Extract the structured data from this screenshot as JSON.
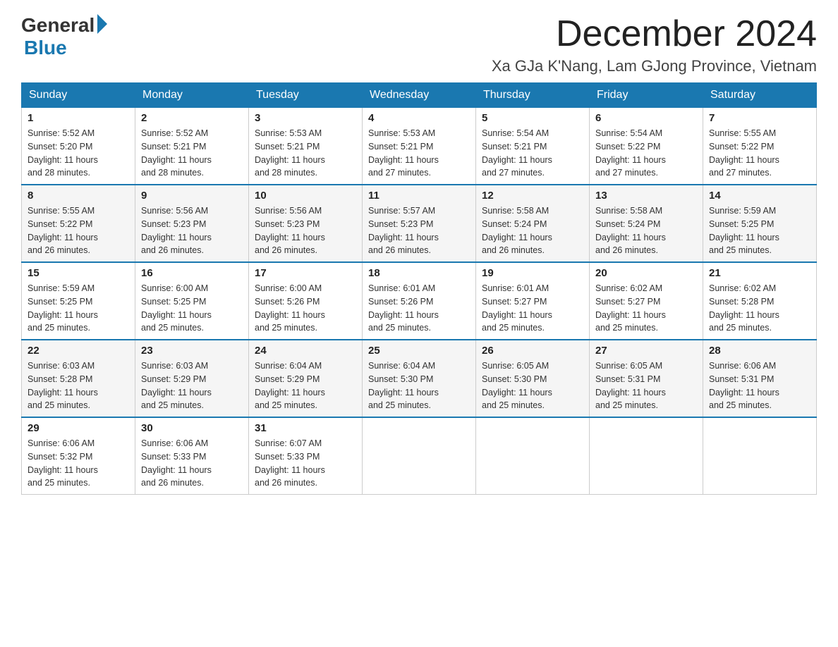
{
  "header": {
    "logo_general": "General",
    "logo_blue": "Blue",
    "month_title": "December 2024",
    "location": "Xa GJa K'Nang, Lam GJong Province, Vietnam"
  },
  "days_of_week": [
    "Sunday",
    "Monday",
    "Tuesday",
    "Wednesday",
    "Thursday",
    "Friday",
    "Saturday"
  ],
  "weeks": [
    [
      {
        "day": "1",
        "sunrise": "5:52 AM",
        "sunset": "5:20 PM",
        "daylight": "11 hours and 28 minutes."
      },
      {
        "day": "2",
        "sunrise": "5:52 AM",
        "sunset": "5:21 PM",
        "daylight": "11 hours and 28 minutes."
      },
      {
        "day": "3",
        "sunrise": "5:53 AM",
        "sunset": "5:21 PM",
        "daylight": "11 hours and 28 minutes."
      },
      {
        "day": "4",
        "sunrise": "5:53 AM",
        "sunset": "5:21 PM",
        "daylight": "11 hours and 27 minutes."
      },
      {
        "day": "5",
        "sunrise": "5:54 AM",
        "sunset": "5:21 PM",
        "daylight": "11 hours and 27 minutes."
      },
      {
        "day": "6",
        "sunrise": "5:54 AM",
        "sunset": "5:22 PM",
        "daylight": "11 hours and 27 minutes."
      },
      {
        "day": "7",
        "sunrise": "5:55 AM",
        "sunset": "5:22 PM",
        "daylight": "11 hours and 27 minutes."
      }
    ],
    [
      {
        "day": "8",
        "sunrise": "5:55 AM",
        "sunset": "5:22 PM",
        "daylight": "11 hours and 26 minutes."
      },
      {
        "day": "9",
        "sunrise": "5:56 AM",
        "sunset": "5:23 PM",
        "daylight": "11 hours and 26 minutes."
      },
      {
        "day": "10",
        "sunrise": "5:56 AM",
        "sunset": "5:23 PM",
        "daylight": "11 hours and 26 minutes."
      },
      {
        "day": "11",
        "sunrise": "5:57 AM",
        "sunset": "5:23 PM",
        "daylight": "11 hours and 26 minutes."
      },
      {
        "day": "12",
        "sunrise": "5:58 AM",
        "sunset": "5:24 PM",
        "daylight": "11 hours and 26 minutes."
      },
      {
        "day": "13",
        "sunrise": "5:58 AM",
        "sunset": "5:24 PM",
        "daylight": "11 hours and 26 minutes."
      },
      {
        "day": "14",
        "sunrise": "5:59 AM",
        "sunset": "5:25 PM",
        "daylight": "11 hours and 25 minutes."
      }
    ],
    [
      {
        "day": "15",
        "sunrise": "5:59 AM",
        "sunset": "5:25 PM",
        "daylight": "11 hours and 25 minutes."
      },
      {
        "day": "16",
        "sunrise": "6:00 AM",
        "sunset": "5:25 PM",
        "daylight": "11 hours and 25 minutes."
      },
      {
        "day": "17",
        "sunrise": "6:00 AM",
        "sunset": "5:26 PM",
        "daylight": "11 hours and 25 minutes."
      },
      {
        "day": "18",
        "sunrise": "6:01 AM",
        "sunset": "5:26 PM",
        "daylight": "11 hours and 25 minutes."
      },
      {
        "day": "19",
        "sunrise": "6:01 AM",
        "sunset": "5:27 PM",
        "daylight": "11 hours and 25 minutes."
      },
      {
        "day": "20",
        "sunrise": "6:02 AM",
        "sunset": "5:27 PM",
        "daylight": "11 hours and 25 minutes."
      },
      {
        "day": "21",
        "sunrise": "6:02 AM",
        "sunset": "5:28 PM",
        "daylight": "11 hours and 25 minutes."
      }
    ],
    [
      {
        "day": "22",
        "sunrise": "6:03 AM",
        "sunset": "5:28 PM",
        "daylight": "11 hours and 25 minutes."
      },
      {
        "day": "23",
        "sunrise": "6:03 AM",
        "sunset": "5:29 PM",
        "daylight": "11 hours and 25 minutes."
      },
      {
        "day": "24",
        "sunrise": "6:04 AM",
        "sunset": "5:29 PM",
        "daylight": "11 hours and 25 minutes."
      },
      {
        "day": "25",
        "sunrise": "6:04 AM",
        "sunset": "5:30 PM",
        "daylight": "11 hours and 25 minutes."
      },
      {
        "day": "26",
        "sunrise": "6:05 AM",
        "sunset": "5:30 PM",
        "daylight": "11 hours and 25 minutes."
      },
      {
        "day": "27",
        "sunrise": "6:05 AM",
        "sunset": "5:31 PM",
        "daylight": "11 hours and 25 minutes."
      },
      {
        "day": "28",
        "sunrise": "6:06 AM",
        "sunset": "5:31 PM",
        "daylight": "11 hours and 25 minutes."
      }
    ],
    [
      {
        "day": "29",
        "sunrise": "6:06 AM",
        "sunset": "5:32 PM",
        "daylight": "11 hours and 25 minutes."
      },
      {
        "day": "30",
        "sunrise": "6:06 AM",
        "sunset": "5:33 PM",
        "daylight": "11 hours and 26 minutes."
      },
      {
        "day": "31",
        "sunrise": "6:07 AM",
        "sunset": "5:33 PM",
        "daylight": "11 hours and 26 minutes."
      },
      null,
      null,
      null,
      null
    ]
  ],
  "labels": {
    "sunrise": "Sunrise:",
    "sunset": "Sunset:",
    "daylight": "Daylight:"
  }
}
